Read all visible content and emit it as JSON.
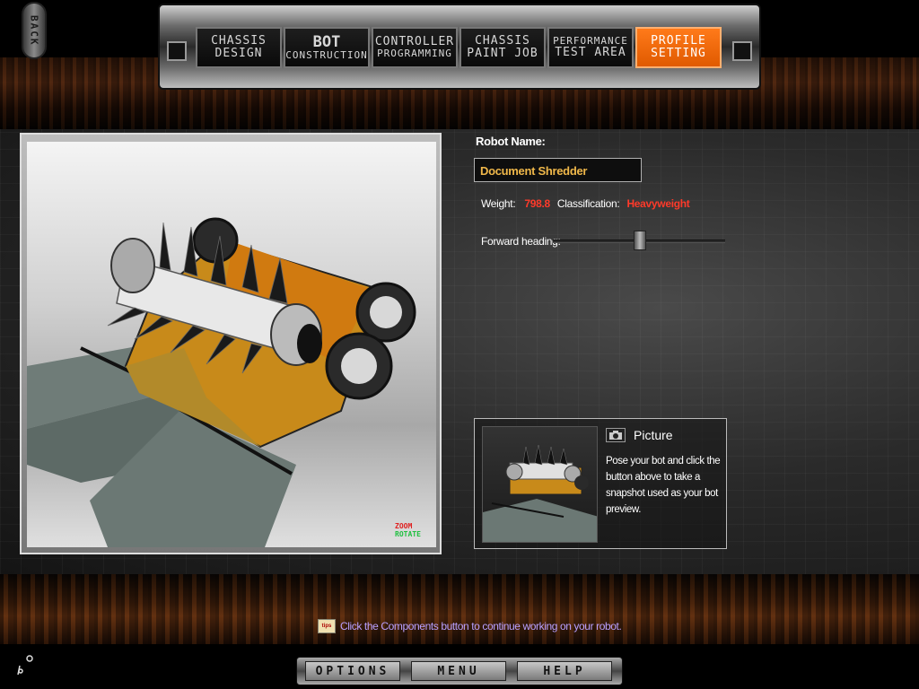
{
  "nav": {
    "back_label": "BACK",
    "tabs": [
      {
        "line1": "CHASSIS",
        "line2": "DESIGN",
        "style": "normal"
      },
      {
        "line1": "BOT",
        "line2": "CONSTRUCTION",
        "style": "big"
      },
      {
        "line1": "CONTROLLER",
        "line2": "PROGRAMMING",
        "style": "normal"
      },
      {
        "line1": "CHASSIS",
        "line2": "PAINT JOB",
        "style": "normal"
      },
      {
        "line1": "PERFORMANCE",
        "line2": "TEST AREA",
        "style": "normal"
      },
      {
        "line1": "PROFILE",
        "line2": "SETTING",
        "style": "active"
      }
    ],
    "active_color": "#ff6a0a"
  },
  "viewport": {
    "zoom_label": "ZOOM",
    "rotate_label": "ROTATE"
  },
  "profile": {
    "name_label": "Robot Name:",
    "name_value": "Document Shredder",
    "weight_label": "Weight:",
    "weight_value": "798.8",
    "classification_label": "Classification:",
    "classification_value": "Heavyweight",
    "heading_label": "Forward heading:"
  },
  "picture": {
    "icon": "camera-icon",
    "title": "Picture",
    "description": "Pose your bot and click the button above to take a snapshot used as your bot preview."
  },
  "tip": {
    "icon": "tips-icon",
    "icon_label": "tips",
    "text": "Click the Components button to continue working on your robot."
  },
  "menu": {
    "options_label": "OPTIONS",
    "menu_label": "MENU",
    "help_label": "HELP"
  },
  "colors": {
    "accent_orange": "#ff6a0a",
    "value_red": "#ff3a2a",
    "name_gold": "#f0b84a",
    "tip_purple": "#b9a0ff"
  }
}
